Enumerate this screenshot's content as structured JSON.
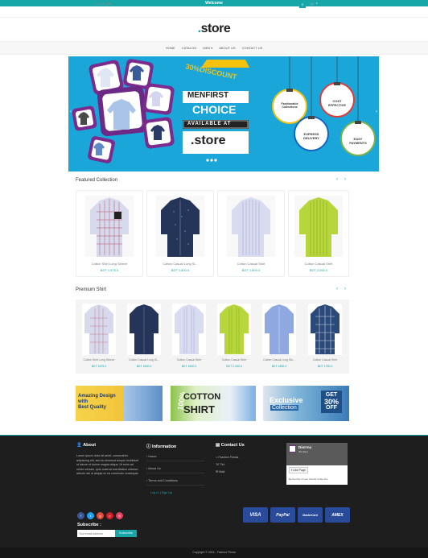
{
  "topbar": {
    "welcome": "Welcome"
  },
  "header": {
    "phone": "(02) 456 7890",
    "cart_count": "0",
    "login": "Log In",
    "sep": "|",
    "signup": "Sign Up"
  },
  "logo": {
    "dot": ".",
    "text": "store"
  },
  "nav": {
    "items": [
      "HOME",
      "CATALOG",
      "MEN",
      "ABOUT US",
      "CONTACT US"
    ]
  },
  "banner": {
    "discount": "30%DISCOUNT",
    "line1": "MENFIRST",
    "line2": "CHOICE",
    "available": "AVAILABLE AT",
    "store": ".store",
    "ornaments": [
      {
        "l1": "Fashionable",
        "l2": "Collections"
      },
      {
        "l1": "COST",
        "l2": "EFFECTIVE"
      },
      {
        "l1": "EXPRESS",
        "l2": "DELIVERY"
      },
      {
        "l1": "EASY",
        "l2": "PAYMENTS"
      }
    ]
  },
  "featured": {
    "title": "Featured Collection",
    "products": [
      {
        "name": "Cotton Shirt Long Sleeve",
        "price": "BDT 1,575.0"
      },
      {
        "name": "Cotton Casual Long Sl...",
        "price": "BDT 1,800.0"
      },
      {
        "name": "Cotton Casual Shirt",
        "price": "BDT 1,800.0"
      },
      {
        "name": "Cotton Casual Shirt",
        "price": "BDT 2,050.0"
      }
    ]
  },
  "premium": {
    "title": "Premium Shirt",
    "products": [
      {
        "name": "Cotton Shirt Long Sleeve",
        "price": "BDT 1575.0"
      },
      {
        "name": "Cotton Casual Long Sl...",
        "price": "BDT 1800.0"
      },
      {
        "name": "Cotton Casual Shirt",
        "price": "BDT 1800.0"
      },
      {
        "name": "Cotton Casual Shirt",
        "price": "BDT 2,050.0"
      },
      {
        "name": "Cotton Casual Long Sle...",
        "price": "BDT 1850.0"
      },
      {
        "name": "Cotton Casual Shirt",
        "price": "BDT 1750.0"
      }
    ]
  },
  "promos": {
    "p1_l1": "Amazing Design",
    "p1_l2": "with",
    "p1_l3": "Best Quality",
    "p2_pct": "100%",
    "p2_l1": "COTTON",
    "p2_l2": "SHIRT",
    "p3_l1": "Exclusive",
    "p3_l2": "Collection",
    "p3_get": "GET",
    "p3_pct": "30%",
    "p3_off": "OFF"
  },
  "footer": {
    "about_title": "About",
    "about_text": "Lorem ipsum dolor sit amet, consectetur adipiscing elit, sed do eiusmod tempor incididunt ut labore et dolore magna aliqua. Ut enim ad minim veniam, quis nostrud exercitation ullamco laboris nisi ut aliquip ex ea commodo consequat.",
    "info_title": "Information",
    "info_links": [
      "Home",
      "About Us",
      "Terms and Conditions"
    ],
    "info_login": "Log In | Sign Up",
    "contact_title": "Contact Us",
    "contact_items": [
      "Fashion Fiesta",
      "Tel:",
      "Mail:"
    ],
    "fb_name": "Diorrna",
    "fb_likes": "301 likes",
    "fb_like_btn": "Like Page",
    "fb_caption": "Be the first of your friends to like this",
    "subscribe_title": "Subscribe :",
    "subscribe_placeholder": "Your email address",
    "subscribe_btn": "Subscribe",
    "payments": [
      "VISA",
      "PayPal",
      "MasterCard",
      "AMEX"
    ]
  },
  "copyright": "Copyright © 2016 - Fashion Fiesta"
}
